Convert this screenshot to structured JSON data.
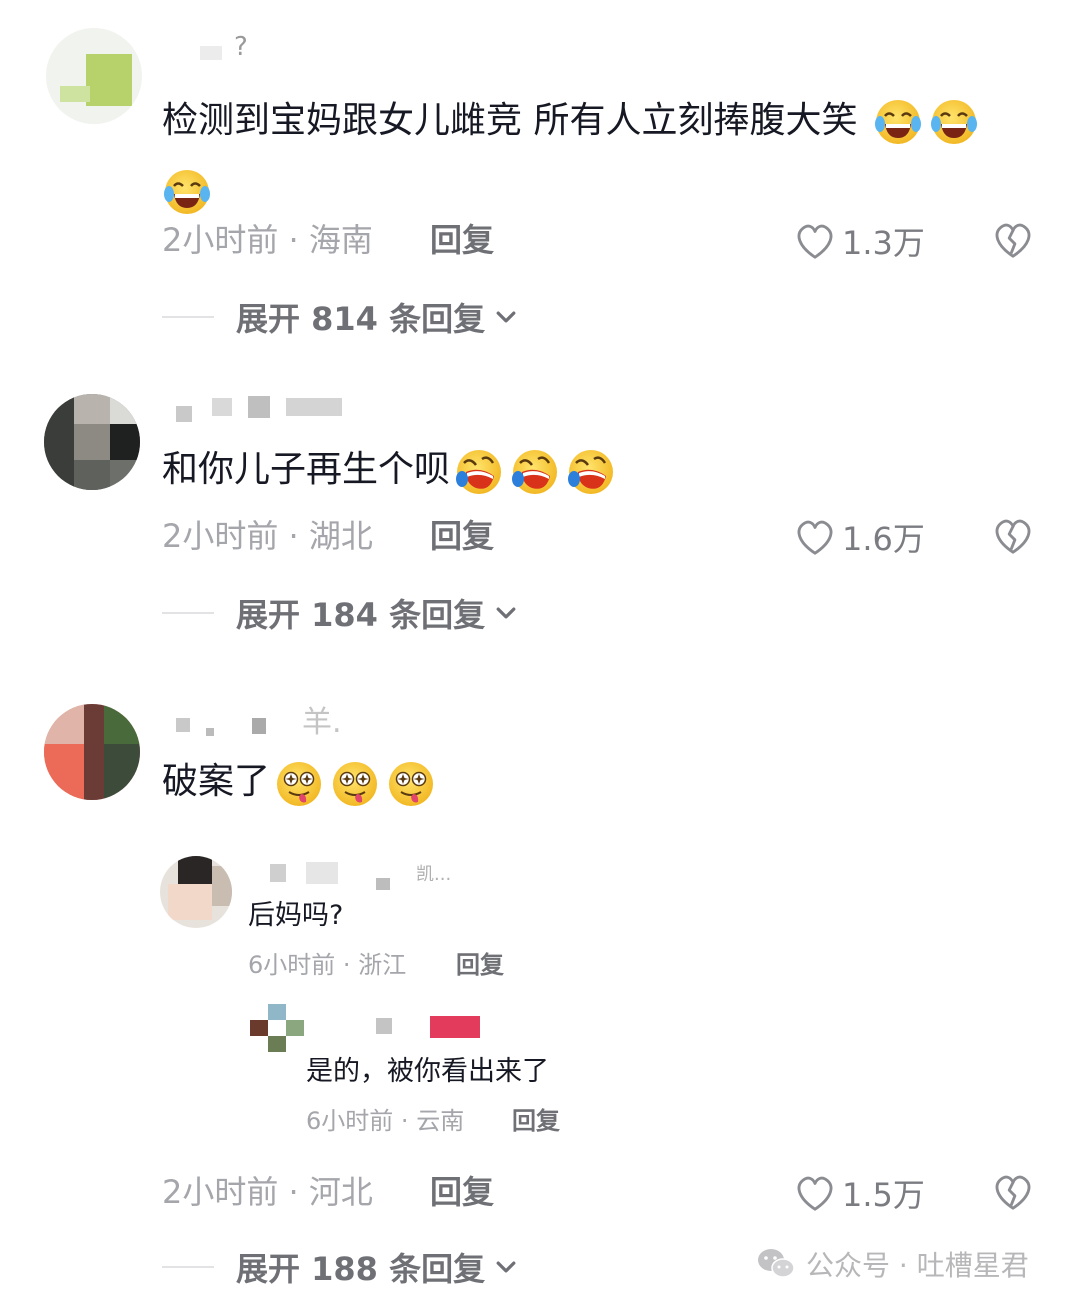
{
  "comments": [
    {
      "username_visible": "?",
      "text": "检测到宝妈跟女儿雌竞 所有人立刻捧腹大笑",
      "emoji_names": [
        "tears-of-joy-emoji",
        "tears-of-joy-emoji",
        "tears-of-joy-emoji"
      ],
      "time": "2小时前",
      "region": "海南",
      "reply_label": "回复",
      "likes": "1.3万",
      "expand_label": "展开 814 条回复"
    },
    {
      "text": "和你儿子再生个呗",
      "emoji_names": [
        "rofl-emoji",
        "rofl-emoji",
        "rofl-emoji"
      ],
      "time": "2小时前",
      "region": "湖北",
      "reply_label": "回复",
      "likes": "1.6万",
      "expand_label": "展开 184 条回复"
    },
    {
      "username_visible": "羊.",
      "text": "破案了",
      "emoji_names": [
        "dizzy-tongue-emoji",
        "dizzy-tongue-emoji",
        "dizzy-tongue-emoji"
      ],
      "time": "2小时前",
      "region": "河北",
      "reply_label": "回复",
      "likes": "1.5万",
      "expand_label": "展开 188 条回复",
      "replies": [
        {
          "username_visible": "凯...",
          "text": "后妈吗?",
          "time": "6小时前",
          "region": "浙江",
          "reply_label": "回复"
        },
        {
          "text": "是的，被你看出来了",
          "time": "6小时前",
          "region": "云南",
          "reply_label": "回复"
        }
      ]
    }
  ],
  "meta_separator": "·",
  "watermark": {
    "icon": "wechat-icon",
    "text": "公众号 · 吐槽星君"
  },
  "colors": {
    "text": "#161823",
    "meta": "#a5a6ab",
    "emoji_yellow": "#f7c531",
    "emoji_mouth": "#8a2a1a"
  }
}
